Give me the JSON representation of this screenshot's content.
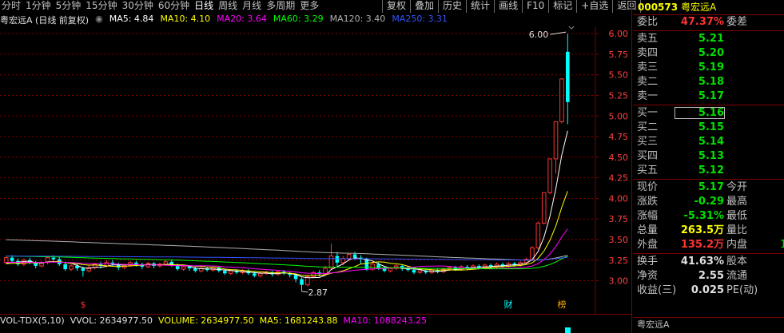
{
  "tabs": [
    "分时",
    "1分钟",
    "5分钟",
    "15分钟",
    "30分钟",
    "60分钟",
    "日线",
    "周线",
    "月线",
    "多周期",
    "更多"
  ],
  "active_tab": "日线",
  "tools": [
    "复权",
    "叠加",
    "历史",
    "统计",
    "画线",
    "F10",
    "标记",
    "+自选",
    "返回"
  ],
  "ma_legend": {
    "title": "粤宏远A (日线 前复权)",
    "ma5": "MA5: 4.84",
    "ma10": "MA10: 4.10",
    "ma20": "MA20: 3.64",
    "ma60": "MA60: 3.29",
    "ma120": "MA120: 3.40",
    "ma250": "MA250: 3.31"
  },
  "colors": {
    "up": "#ff3333",
    "down": "#00ffff",
    "ma5": "#ffffff",
    "ma10": "#ffff00",
    "ma20": "#ff00ff",
    "ma60": "#00ff00",
    "ma120": "#b0b0b0",
    "ma250": "#3355ff"
  },
  "chart_data": {
    "type": "candlestick",
    "y_ticks": [
      "6.00",
      "5.75",
      "5.50",
      "5.25",
      "5.00",
      "4.75",
      "4.50",
      "4.25",
      "4.00",
      "3.75",
      "3.50",
      "3.25",
      "3.00"
    ],
    "ylim": [
      2.85,
      6.05
    ],
    "high_label": "6.00",
    "low_label": "2.87",
    "markers": [
      "$",
      "财",
      "榜"
    ],
    "candles": [
      [
        3.22,
        3.28,
        3.2,
        3.3
      ],
      [
        3.28,
        3.24,
        3.22,
        3.31
      ],
      [
        3.24,
        3.2,
        3.18,
        3.27
      ],
      [
        3.2,
        3.25,
        3.18,
        3.27
      ],
      [
        3.25,
        3.22,
        3.2,
        3.28
      ],
      [
        3.22,
        3.18,
        3.15,
        3.24
      ],
      [
        3.18,
        3.22,
        3.16,
        3.24
      ],
      [
        3.22,
        3.28,
        3.2,
        3.3
      ],
      [
        3.28,
        3.26,
        3.22,
        3.31
      ],
      [
        3.26,
        3.2,
        3.18,
        3.29
      ],
      [
        3.2,
        3.14,
        3.12,
        3.23
      ],
      [
        3.14,
        3.18,
        3.12,
        3.2
      ],
      [
        3.18,
        3.15,
        3.12,
        3.21
      ],
      [
        3.15,
        3.12,
        3.05,
        3.17
      ],
      [
        3.12,
        3.16,
        3.1,
        3.19
      ],
      [
        3.16,
        3.2,
        3.14,
        3.22
      ],
      [
        3.2,
        3.18,
        3.15,
        3.23
      ],
      [
        3.18,
        3.22,
        3.16,
        3.25
      ],
      [
        3.22,
        3.2,
        3.17,
        3.25
      ],
      [
        3.2,
        3.16,
        3.13,
        3.22
      ],
      [
        3.16,
        3.19,
        3.14,
        3.21
      ],
      [
        3.19,
        3.22,
        3.17,
        3.24
      ],
      [
        3.22,
        3.2,
        3.17,
        3.24
      ],
      [
        3.2,
        3.17,
        3.14,
        3.22
      ],
      [
        3.17,
        3.21,
        3.15,
        3.23
      ],
      [
        3.21,
        3.18,
        3.15,
        3.23
      ],
      [
        3.18,
        3.2,
        3.16,
        3.22
      ],
      [
        3.2,
        3.23,
        3.18,
        3.26
      ],
      [
        3.23,
        3.19,
        3.17,
        3.25
      ],
      [
        3.19,
        3.14,
        3.12,
        3.21
      ],
      [
        3.14,
        3.17,
        3.12,
        3.19
      ],
      [
        3.17,
        3.15,
        3.12,
        3.19
      ],
      [
        3.15,
        3.12,
        3.1,
        3.17
      ],
      [
        3.12,
        3.15,
        3.1,
        3.17
      ],
      [
        3.15,
        3.13,
        3.11,
        3.17
      ],
      [
        3.13,
        3.16,
        3.11,
        3.18
      ],
      [
        3.16,
        3.12,
        3.1,
        3.18
      ],
      [
        3.12,
        3.09,
        3.07,
        3.14
      ],
      [
        3.09,
        3.12,
        3.07,
        3.14
      ],
      [
        3.12,
        3.1,
        3.08,
        3.14
      ],
      [
        3.1,
        3.12,
        3.08,
        3.14
      ],
      [
        3.12,
        3.09,
        3.07,
        3.14
      ],
      [
        3.09,
        3.06,
        3.04,
        3.11
      ],
      [
        3.06,
        3.09,
        3.04,
        3.11
      ],
      [
        3.09,
        3.1,
        3.07,
        3.12
      ],
      [
        3.1,
        3.08,
        3.05,
        3.12
      ],
      [
        3.08,
        3.11,
        3.06,
        3.13
      ],
      [
        3.11,
        3.09,
        3.07,
        3.13
      ],
      [
        3.09,
        3.07,
        3.04,
        3.11
      ],
      [
        3.07,
        3.02,
        2.98,
        3.09
      ],
      [
        3.02,
        2.95,
        2.87,
        3.04
      ],
      [
        2.95,
        3.05,
        2.93,
        3.07
      ],
      [
        3.05,
        3.1,
        3.03,
        3.12
      ],
      [
        3.1,
        3.08,
        3.05,
        3.13
      ],
      [
        3.08,
        3.15,
        3.06,
        3.18
      ],
      [
        3.15,
        3.3,
        3.13,
        3.45
      ],
      [
        3.3,
        3.22,
        3.18,
        3.35
      ],
      [
        3.22,
        3.27,
        3.19,
        3.3
      ],
      [
        3.27,
        3.32,
        3.24,
        3.34
      ],
      [
        3.32,
        3.28,
        3.25,
        3.35
      ],
      [
        3.28,
        3.26,
        3.2,
        3.31
      ],
      [
        3.26,
        3.14,
        3.12,
        3.28
      ],
      [
        3.14,
        3.2,
        3.12,
        3.23
      ],
      [
        3.2,
        3.15,
        3.13,
        3.22
      ],
      [
        3.15,
        3.12,
        3.1,
        3.18
      ],
      [
        3.12,
        3.15,
        3.1,
        3.17
      ],
      [
        3.15,
        3.18,
        3.13,
        3.2
      ],
      [
        3.18,
        3.15,
        3.12,
        3.2
      ],
      [
        3.15,
        3.13,
        3.11,
        3.17
      ],
      [
        3.13,
        3.1,
        3.08,
        3.15
      ],
      [
        3.1,
        3.12,
        3.08,
        3.14
      ],
      [
        3.12,
        3.1,
        3.08,
        3.14
      ],
      [
        3.1,
        3.13,
        3.08,
        3.15
      ],
      [
        3.13,
        3.11,
        3.09,
        3.15
      ],
      [
        3.11,
        3.14,
        3.09,
        3.16
      ],
      [
        3.14,
        3.16,
        3.12,
        3.18
      ],
      [
        3.16,
        3.14,
        3.12,
        3.18
      ],
      [
        3.14,
        3.17,
        3.12,
        3.19
      ],
      [
        3.17,
        3.15,
        3.13,
        3.19
      ],
      [
        3.15,
        3.18,
        3.13,
        3.2
      ],
      [
        3.18,
        3.16,
        3.14,
        3.2
      ],
      [
        3.16,
        3.19,
        3.14,
        3.21
      ],
      [
        3.19,
        3.17,
        3.15,
        3.21
      ],
      [
        3.17,
        3.2,
        3.15,
        3.22
      ],
      [
        3.2,
        3.18,
        3.16,
        3.22
      ],
      [
        3.18,
        3.21,
        3.16,
        3.23
      ],
      [
        3.21,
        3.19,
        3.17,
        3.23
      ],
      [
        3.19,
        3.22,
        3.17,
        3.24
      ],
      [
        3.22,
        3.26,
        3.2,
        3.28
      ],
      [
        3.26,
        3.4,
        3.24,
        3.42
      ],
      [
        3.4,
        3.7,
        3.38,
        3.72
      ],
      [
        3.7,
        4.07,
        3.68,
        4.07
      ],
      [
        4.07,
        4.48,
        4.05,
        4.48
      ],
      [
        4.48,
        4.93,
        4.3,
        4.93
      ],
      [
        4.93,
        5.45,
        4.91,
        5.46
      ],
      [
        5.78,
        5.17,
        4.9,
        6.0
      ]
    ],
    "volume_bar_last": 2634977.5
  },
  "vol_legend": {
    "title": "VOL-TDX(5,10)",
    "vvol": "VVOL: 2634977.50",
    "volume": "VOLUME: 2634977.50",
    "ma5": "MA5: 1681243.88",
    "ma10": "MA10: 1088243.25"
  },
  "panel": {
    "code": "000573",
    "name": "粤宏远A",
    "weibi_label": "委比",
    "weibi_value": "47.37%",
    "weicha_label": "委差",
    "asks": [
      {
        "label": "卖五",
        "price": "5.21"
      },
      {
        "label": "卖四",
        "price": "5.20"
      },
      {
        "label": "卖三",
        "price": "5.19"
      },
      {
        "label": "卖二",
        "price": "5.18"
      },
      {
        "label": "卖一",
        "price": "5.17"
      }
    ],
    "bids": [
      {
        "label": "买一",
        "price": "5.16"
      },
      {
        "label": "买二",
        "price": "5.15"
      },
      {
        "label": "买三",
        "price": "5.14"
      },
      {
        "label": "买四",
        "price": "5.13"
      },
      {
        "label": "买五",
        "price": "5.12"
      }
    ],
    "stats": [
      {
        "label": "现价",
        "value": "5.17",
        "color": "#00e000",
        "label2": "今开"
      },
      {
        "label": "涨跌",
        "value": "-0.29",
        "color": "#00e000",
        "label2": "最高"
      },
      {
        "label": "涨幅",
        "value": "-5.31%",
        "color": "#00e000",
        "label2": "最低"
      },
      {
        "label": "总量",
        "value": "263.5万",
        "color": "#ffff00",
        "label2": "量比"
      },
      {
        "label": "外盘",
        "value": "135.2万",
        "color": "#ff3333",
        "label2": "内盘",
        "value2": "1"
      }
    ],
    "stats2": [
      {
        "label": "换手",
        "value": "41.63%",
        "label2": "股本"
      },
      {
        "label": "净资",
        "value": "2.55",
        "label2": "流通"
      },
      {
        "label": "收益(三)",
        "value": "0.025",
        "label2": "PE(动)"
      }
    ],
    "bottom_name": "粤宏远A"
  }
}
